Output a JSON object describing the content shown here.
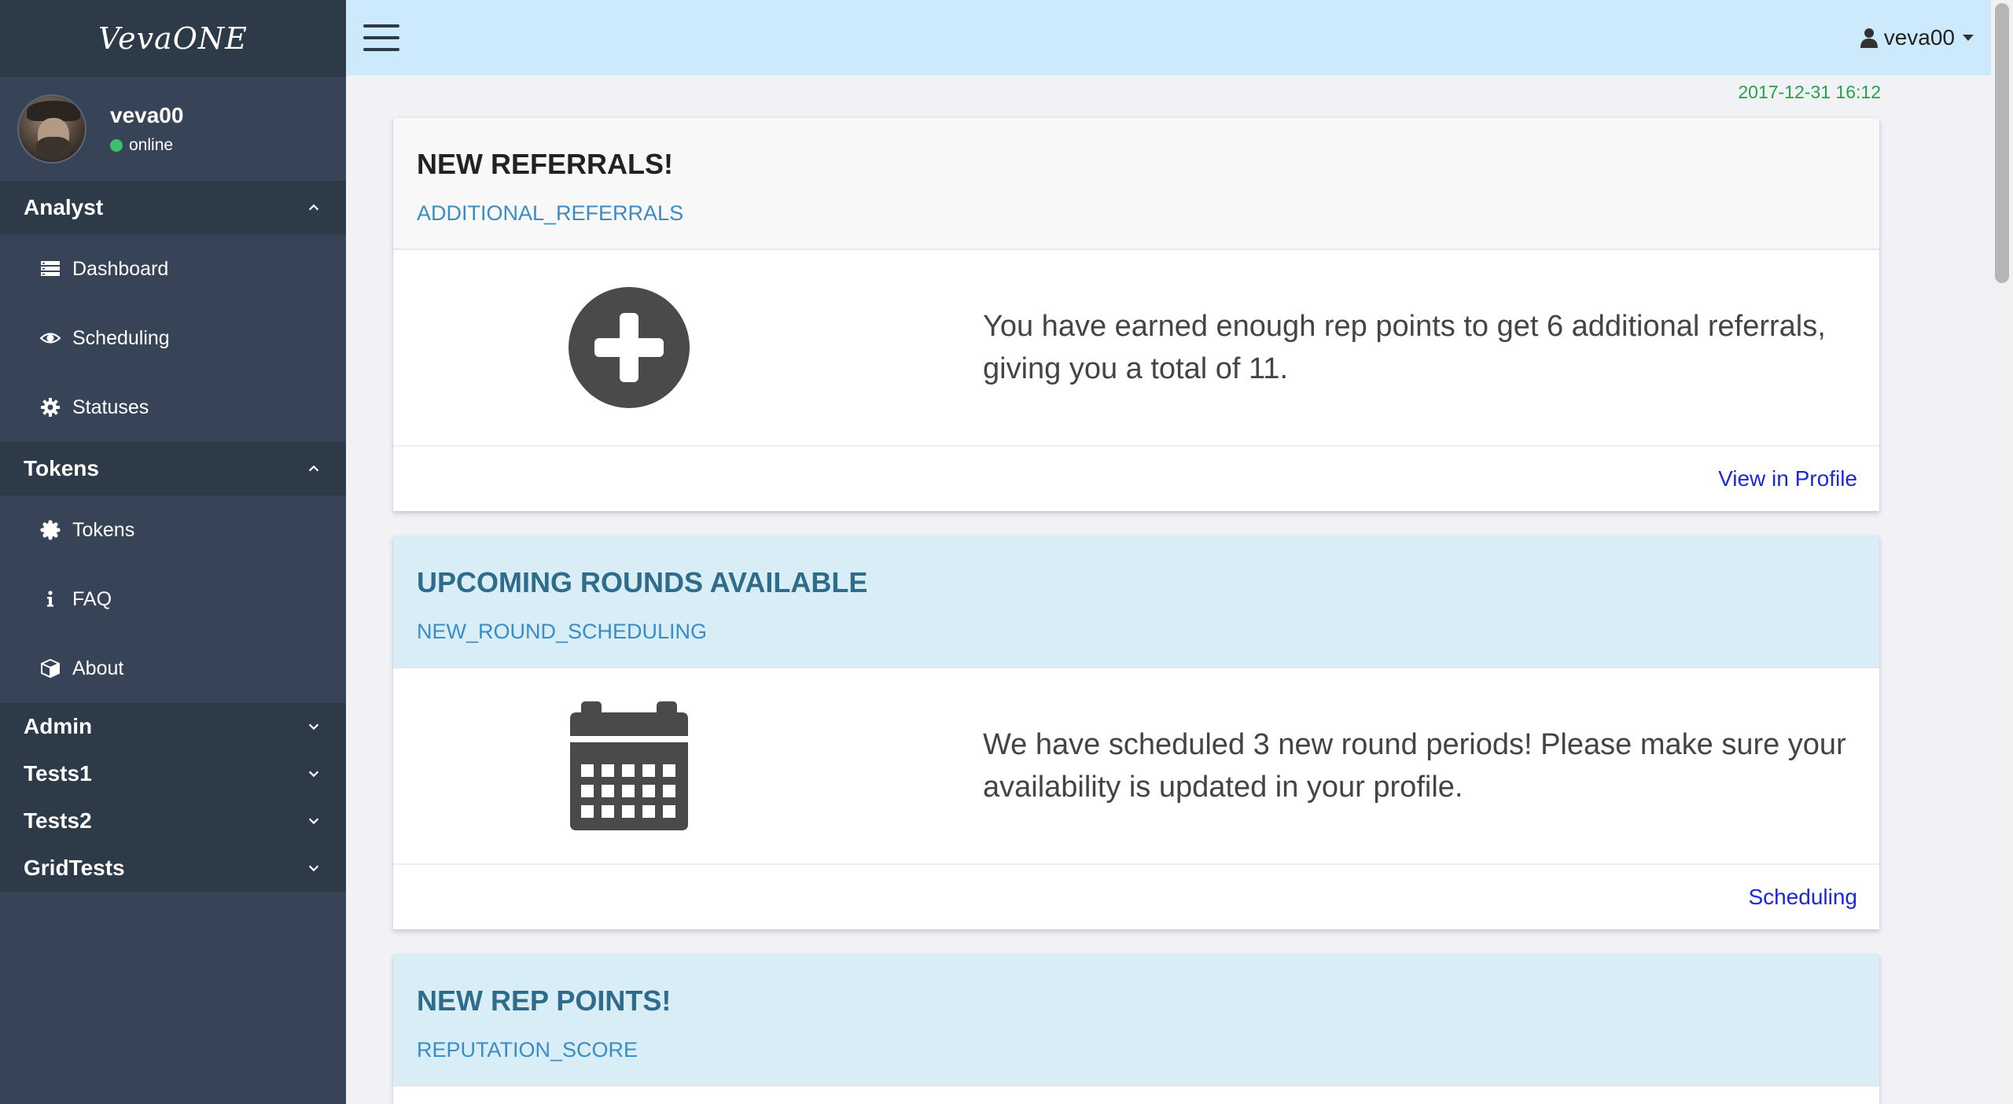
{
  "app": {
    "brand": "VevaONE"
  },
  "user": {
    "name": "veva00",
    "status": "online"
  },
  "sidebar": {
    "sections": [
      {
        "label": "Analyst",
        "expanded": true,
        "items": [
          {
            "label": "Dashboard",
            "icon": "dashboard-icon"
          },
          {
            "label": "Scheduling",
            "icon": "eye-icon"
          },
          {
            "label": "Statuses",
            "icon": "gear-icon"
          }
        ]
      },
      {
        "label": "Tokens",
        "expanded": true,
        "items": [
          {
            "label": "Tokens",
            "icon": "badge-icon"
          },
          {
            "label": "FAQ",
            "icon": "info-icon"
          },
          {
            "label": "About",
            "icon": "cube-icon"
          }
        ]
      },
      {
        "label": "Admin",
        "expanded": false
      },
      {
        "label": "Tests1",
        "expanded": false
      },
      {
        "label": "Tests2",
        "expanded": false
      },
      {
        "label": "GridTests",
        "expanded": false
      }
    ]
  },
  "topbar": {
    "user_label": "veva00"
  },
  "main": {
    "timestamp": "2017-12-31 16:12",
    "cards": [
      {
        "title": "NEW REFERRALS!",
        "code": "ADDITIONAL_REFERRALS",
        "text": "You have earned enough rep points to get 6 additional referrals, giving you a total of 11.",
        "link": "View in Profile",
        "icon": "plus-circle-icon",
        "header_style": "white"
      },
      {
        "title": "UPCOMING ROUNDS AVAILABLE",
        "code": "NEW_ROUND_SCHEDULING",
        "text": "We have scheduled 3 new round periods! Please make sure your availability is updated in your profile.",
        "link": "Scheduling",
        "icon": "calendar-icon",
        "header_style": "blue"
      },
      {
        "title": "NEW REP POINTS!",
        "code": "REPUTATION_SCORE",
        "header_style": "blue"
      }
    ]
  },
  "colors": {
    "sidebar_bg": "#374458",
    "sidebar_header_bg": "#2d3a48",
    "topbar_bg": "#cdeafd",
    "timestamp": "#26a04a",
    "link": "#1d28d6",
    "code_text": "#3a8cc4",
    "status_online": "#3cbf6b"
  }
}
